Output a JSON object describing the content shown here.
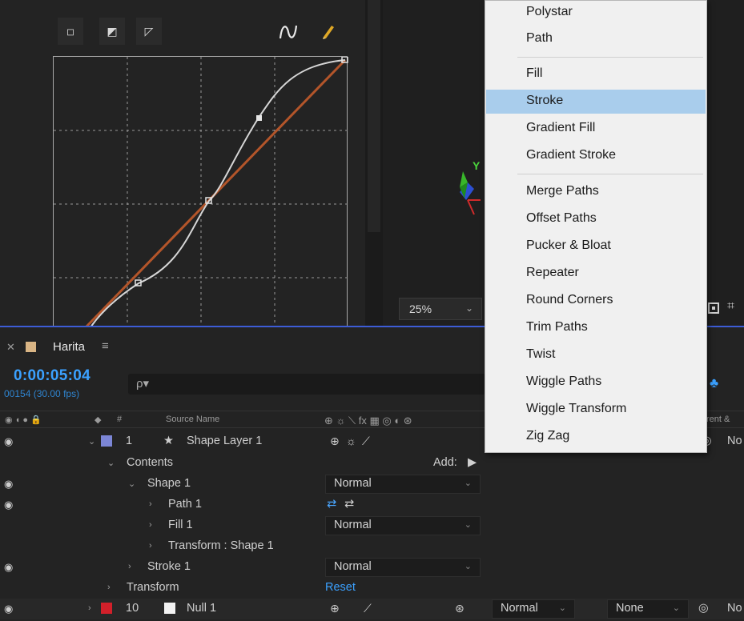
{
  "graph_panel": {
    "modes": [
      "◽",
      "◩",
      "◸"
    ]
  },
  "comp_viewer": {
    "zoom": "25%"
  },
  "timeline": {
    "tab_name": "Harita",
    "tab_menu": "≡",
    "timecode": "0:00:05:04",
    "fps_readout": "00154 (30.00 fps)",
    "search_glyph": "ρ▾",
    "column_header": {
      "hash": "#",
      "source_name": "Source Name",
      "switches": "⊕ ☼ ⟍ fx ▦ ◎ ◐ ⊛",
      "parent": "rent &"
    },
    "layers": [
      {
        "num": "1",
        "name": "Shape Layer 1",
        "color": "#7c86d6"
      },
      {
        "num": "10",
        "name": "Null 1",
        "color": "#d2202a"
      }
    ],
    "tree": {
      "contents": "Contents",
      "add": "Add:",
      "shape1": "Shape 1",
      "path1": "Path 1",
      "fill1": "Fill 1",
      "transform_shape": "Transform : Shape 1",
      "stroke1": "Stroke 1",
      "transform": "Transform",
      "reset": "Reset"
    },
    "blend_modes": {
      "shape1": "Normal",
      "fill1": "Normal",
      "stroke1": "Normal",
      "null1": "Normal"
    },
    "track_matte": "None",
    "parent_partial": "No"
  },
  "add_menu": {
    "items": [
      {
        "label": "Polystar",
        "highlighted": false
      },
      {
        "label": "Path",
        "highlighted": false
      },
      {
        "label": "Fill",
        "highlighted": false
      },
      {
        "label": "Stroke",
        "highlighted": true
      },
      {
        "label": "Gradient Fill",
        "highlighted": false
      },
      {
        "label": "Gradient Stroke",
        "highlighted": false
      },
      {
        "label": "Merge Paths",
        "highlighted": false
      },
      {
        "label": "Offset Paths",
        "highlighted": false
      },
      {
        "label": "Pucker & Bloat",
        "highlighted": false
      },
      {
        "label": "Repeater",
        "highlighted": false
      },
      {
        "label": "Round Corners",
        "highlighted": false
      },
      {
        "label": "Trim Paths",
        "highlighted": false
      },
      {
        "label": "Twist",
        "highlighted": false
      },
      {
        "label": "Wiggle Paths",
        "highlighted": false
      },
      {
        "label": "Wiggle Transform",
        "highlighted": false
      },
      {
        "label": "Zig Zag",
        "highlighted": false
      }
    ]
  }
}
